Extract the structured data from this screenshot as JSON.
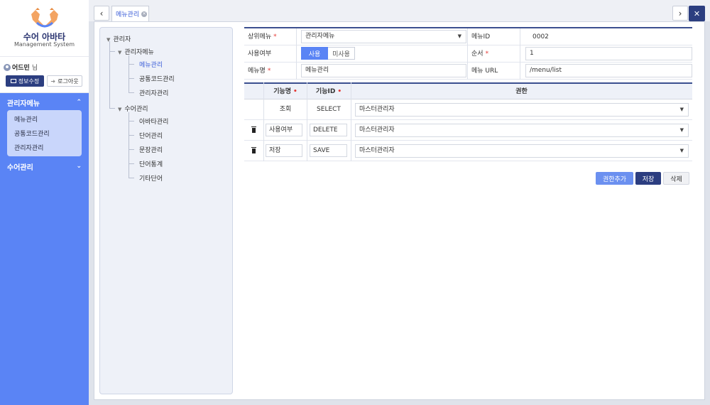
{
  "app": {
    "title": "수어 아바타",
    "subtitle": "Management System"
  },
  "user": {
    "name": "어드민",
    "suffix": "님",
    "info_button": "정보수정",
    "logout_button": "로그아웃"
  },
  "sidebar": {
    "groups": [
      {
        "label": "관리자메뉴",
        "expanded": true,
        "items": [
          {
            "label": "메뉴관리"
          },
          {
            "label": "공통코드관리"
          },
          {
            "label": "관리자관리"
          }
        ]
      },
      {
        "label": "수어관리",
        "expanded": false
      }
    ]
  },
  "tabs": [
    {
      "label": "메뉴관리",
      "active": true
    }
  ],
  "tree": {
    "root": "관리자",
    "nodes": [
      {
        "label": "관리자메뉴",
        "children": [
          {
            "label": "메뉴관리",
            "active": true
          },
          {
            "label": "공통코드관리"
          },
          {
            "label": "관리자관리"
          }
        ]
      },
      {
        "label": "수어관리",
        "children": [
          {
            "label": "아바타관리"
          },
          {
            "label": "단어관리"
          },
          {
            "label": "문장관리"
          },
          {
            "label": "단어통계"
          },
          {
            "label": "기타단어"
          }
        ]
      }
    ]
  },
  "form": {
    "parent_menu": {
      "label": "상위메뉴",
      "value": "관리자메뉴"
    },
    "menu_id": {
      "label": "메뉴ID",
      "value": "0002"
    },
    "use_yn": {
      "label": "사용여부",
      "options": [
        "사용",
        "미사용"
      ],
      "selected": "사용"
    },
    "order": {
      "label": "순서",
      "value": "1"
    },
    "menu_name": {
      "label": "메뉴명",
      "value": "메뉴관리"
    },
    "menu_url": {
      "label": "메뉴 URL",
      "value": "/menu/list"
    }
  },
  "table": {
    "headers": {
      "func_name": "기능명",
      "func_id": "기능ID",
      "permission": "권한"
    },
    "rows": [
      {
        "func_name": "조회",
        "func_id": "SELECT",
        "permission": "마스터관리자",
        "deletable": false
      },
      {
        "func_name": "사용여부",
        "func_id": "DELETE",
        "permission": "마스터관리자",
        "deletable": true
      },
      {
        "func_name": "저장",
        "func_id": "SAVE",
        "permission": "마스터관리자",
        "deletable": true
      }
    ]
  },
  "actions": {
    "add_permission": "권한추가",
    "save": "저장",
    "delete": "삭제"
  },
  "colors": {
    "sidebar": "#5a84f5",
    "navy": "#2c3e80",
    "required": "#e53935",
    "accent": "#3a5dd8"
  }
}
